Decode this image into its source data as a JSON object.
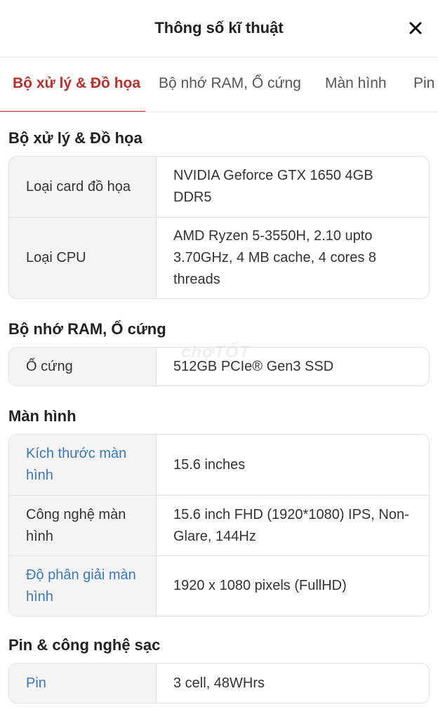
{
  "header": {
    "title": "Thông số kĩ thuật",
    "close_icon": "×"
  },
  "tabs": [
    {
      "label": "Bộ xử lý & Đồ họa",
      "active": true
    },
    {
      "label": "Bộ nhớ RAM, Ổ cứng",
      "active": false
    },
    {
      "label": "Màn hình",
      "active": false
    },
    {
      "label": "Pin",
      "active": false
    }
  ],
  "sections": [
    {
      "title": "Bộ xử lý & Đồ họa",
      "rows": [
        {
          "label": "Loại card đồ họa",
          "value": "NVIDIA Geforce GTX 1650 4GB DDR5",
          "link": false
        },
        {
          "label": "Loại CPU",
          "value": "AMD Ryzen 5-3550H, 2.10 upto 3.70GHz, 4 MB cache, 4 cores 8 threads",
          "link": false
        }
      ]
    },
    {
      "title": "Bộ nhớ RAM, Ổ cứng",
      "rows": [
        {
          "label": "Ổ cứng",
          "value": "512GB PCIe® Gen3 SSD",
          "link": false
        }
      ]
    },
    {
      "title": "Màn hình",
      "rows": [
        {
          "label": "Kích thước màn hình",
          "value": "15.6 inches",
          "link": true
        },
        {
          "label": "Công nghệ màn hình",
          "value": "15.6 inch FHD (1920*1080) IPS, Non-Glare, 144Hz",
          "link": false
        },
        {
          "label": "Độ phân giải màn hình",
          "value": "1920 x 1080 pixels (FullHD)",
          "link": true
        }
      ]
    },
    {
      "title": "Pin & công nghệ sạc",
      "rows": [
        {
          "label": "Pin",
          "value": "3 cell, 48WHrs",
          "link": true
        }
      ]
    }
  ],
  "watermark": "chợTỐT",
  "colors": {
    "accent": "#b9302b",
    "link": "#3a78c4",
    "label_bg": "#f4f4f4",
    "border": "#e2e2e2"
  }
}
